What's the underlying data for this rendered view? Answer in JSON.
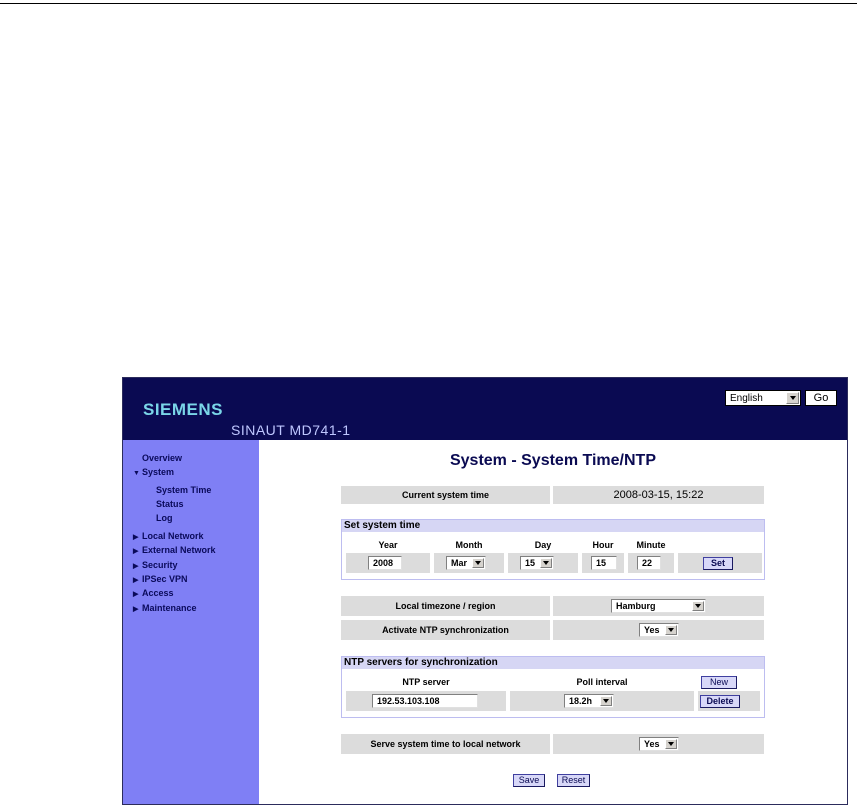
{
  "header": {
    "brand": "SIEMENS",
    "product": "SINAUT MD741-1",
    "language_value": "English",
    "go_label": "Go"
  },
  "sidebar": {
    "items": [
      {
        "label": "Overview"
      },
      {
        "label": "System",
        "expanded": true
      },
      {
        "label": "System Time",
        "sub": true
      },
      {
        "label": "Status",
        "sub": true
      },
      {
        "label": "Log",
        "sub": true
      },
      {
        "label": "Local Network"
      },
      {
        "label": "External Network"
      },
      {
        "label": "Security"
      },
      {
        "label": "IPSec VPN"
      },
      {
        "label": "Access"
      },
      {
        "label": "Maintenance"
      }
    ]
  },
  "main": {
    "title": "System - System Time/NTP",
    "current_time": {
      "label": "Current system time",
      "value": "2008-03-15, 15:22"
    },
    "set_time": {
      "heading": "Set system time",
      "cols": {
        "year": "Year",
        "month": "Month",
        "day": "Day",
        "hour": "Hour",
        "minute": "Minute"
      },
      "values": {
        "year": "2008",
        "month": "Mar",
        "day": "15",
        "hour": "15",
        "minute": "22"
      },
      "set_label": "Set"
    },
    "timezone": {
      "label": "Local timezone / region",
      "value": "Hamburg"
    },
    "ntp_sync": {
      "label": "Activate NTP synchronization",
      "value": "Yes"
    },
    "ntp_servers": {
      "heading": "NTP servers for synchronization",
      "col_server": "NTP server",
      "col_poll": "Poll interval",
      "new_label": "New",
      "rows": [
        {
          "server": "192.53.103.108",
          "poll": "18.2h",
          "delete_label": "Delete"
        }
      ]
    },
    "serve_time": {
      "label": "Serve system time to local network",
      "value": "Yes"
    },
    "save_label": "Save",
    "reset_label": "Reset"
  },
  "colors": {
    "header_bg": "#0a0a52",
    "sidebar_bg": "#7f7ff5",
    "accent": "#7ad6e8"
  }
}
